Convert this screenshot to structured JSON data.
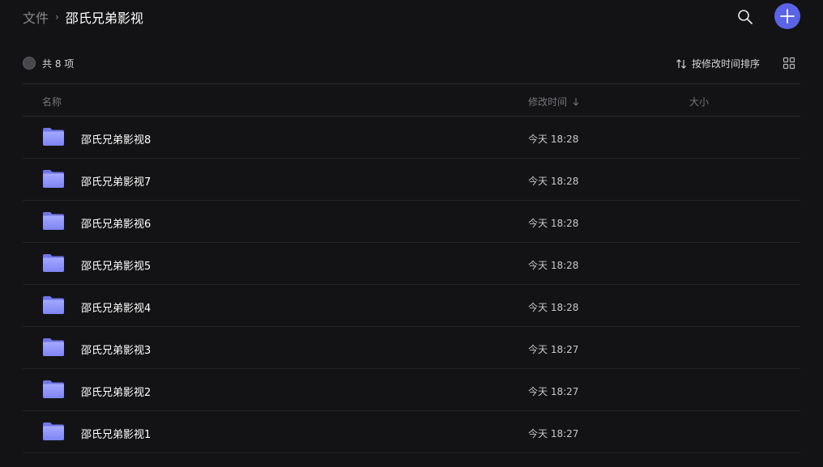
{
  "breadcrumb": {
    "root": "文件",
    "separator": "›",
    "current": "邵氏兄弟影视"
  },
  "header": {
    "search_icon": "search-icon",
    "add_icon": "plus-icon",
    "accent_color": "#5b63e6"
  },
  "toolbar": {
    "count_label": "共 8 项",
    "sort_label": "按修改时间排序",
    "view_icon": "grid-view-icon"
  },
  "columns": {
    "name": "名称",
    "modified": "修改时间",
    "size": "大小"
  },
  "files": [
    {
      "name": "邵氏兄弟影视8",
      "modified": "今天 18:28",
      "size": "",
      "icon": "folder-icon"
    },
    {
      "name": "邵氏兄弟影视7",
      "modified": "今天 18:28",
      "size": "",
      "icon": "folder-icon"
    },
    {
      "name": "邵氏兄弟影视6",
      "modified": "今天 18:28",
      "size": "",
      "icon": "folder-icon"
    },
    {
      "name": "邵氏兄弟影视5",
      "modified": "今天 18:28",
      "size": "",
      "icon": "folder-icon"
    },
    {
      "name": "邵氏兄弟影视4",
      "modified": "今天 18:28",
      "size": "",
      "icon": "folder-icon"
    },
    {
      "name": "邵氏兄弟影视3",
      "modified": "今天 18:27",
      "size": "",
      "icon": "folder-icon"
    },
    {
      "name": "邵氏兄弟影视2",
      "modified": "今天 18:27",
      "size": "",
      "icon": "folder-icon"
    },
    {
      "name": "邵氏兄弟影视1",
      "modified": "今天 18:27",
      "size": "",
      "icon": "folder-icon"
    }
  ]
}
